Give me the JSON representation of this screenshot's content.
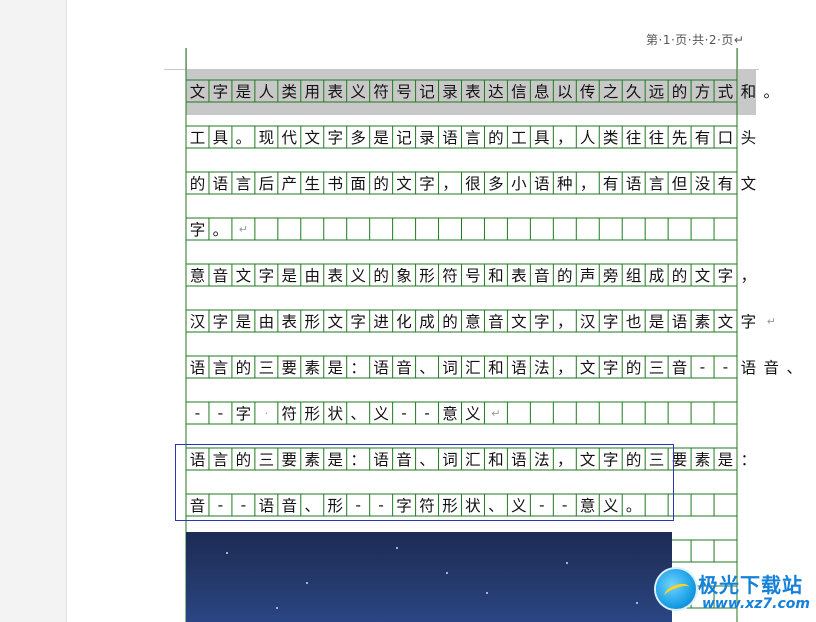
{
  "header": {
    "page_indicator": "第·1·页·共·2·页↵"
  },
  "document": {
    "lines": [
      "文字是人类用表义符号记录表达信息以传之久远的方式和。",
      "工具。现代文字多是记录语言的工具，人类往往先有口头",
      "的语言后产生书面的文字，很多小语种，有语言但没有文",
      "字。↵",
      "意音文字是由表义的象形符号和表音的声旁组成的文字，",
      "汉字是由表形文字进化成的意音文字，汉字也是语素文字↵",
      "语言的三要素是：语音、词汇和语法，文字的三音--语音、",
      "--字·符形状、义--意义↵",
      "语言的三要素是：语音、词汇和语法，文字的三要素是：",
      "音--语音、形--字符形状、义--意义。",
      "",
      ""
    ]
  },
  "watermark": {
    "title": "极光下载站",
    "url": "www.xz7.com"
  },
  "colors": {
    "grid": "#1f7a1f",
    "selection": "#2a35b8",
    "highlight": "#c8c8c8",
    "watermark": "#1581d8"
  },
  "icons": {
    "watermark_logo": "aurora-logo-icon"
  }
}
